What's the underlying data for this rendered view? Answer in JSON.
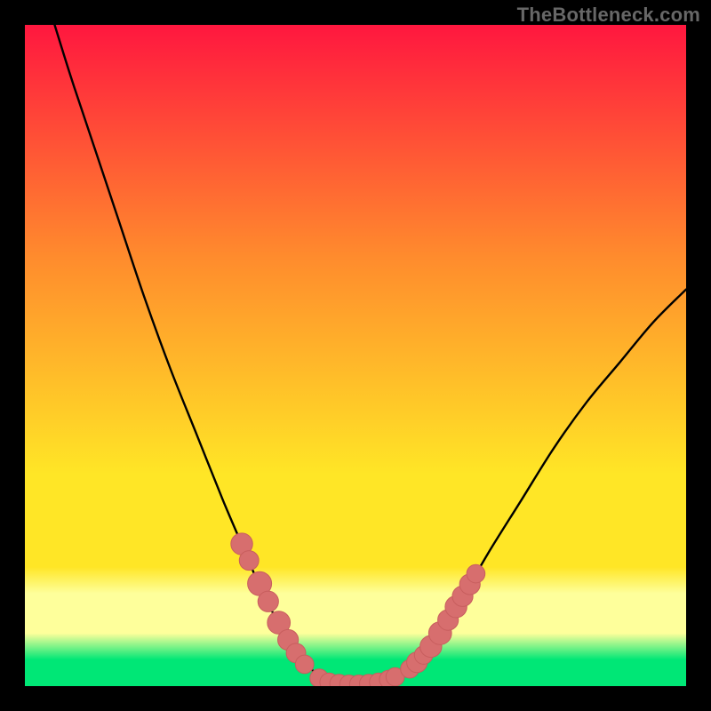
{
  "watermark": "TheBottleneck.com",
  "colors": {
    "frame": "#000000",
    "watermark_text": "#676767",
    "gradient_top": "#ff173f",
    "gradient_mid1": "#ff8b2d",
    "gradient_mid2": "#ffe626",
    "gradient_band": "#feff9b",
    "gradient_bottom": "#00e776",
    "curve_stroke": "#000000",
    "marker_fill": "#d76e6e",
    "marker_stroke": "#c85e5e"
  },
  "chart_data": {
    "type": "line",
    "title": "",
    "xlabel": "",
    "ylabel": "",
    "xlim": [
      0,
      100
    ],
    "ylim": [
      0,
      100
    ],
    "curve": [
      {
        "x": 4.5,
        "y": 100
      },
      {
        "x": 7,
        "y": 92
      },
      {
        "x": 10,
        "y": 83
      },
      {
        "x": 14,
        "y": 71
      },
      {
        "x": 18,
        "y": 59
      },
      {
        "x": 22,
        "y": 48
      },
      {
        "x": 26,
        "y": 38
      },
      {
        "x": 30,
        "y": 28
      },
      {
        "x": 33,
        "y": 21
      },
      {
        "x": 36,
        "y": 14
      },
      {
        "x": 39,
        "y": 8.5
      },
      {
        "x": 42,
        "y": 4
      },
      {
        "x": 45,
        "y": 1.2
      },
      {
        "x": 48,
        "y": 0.3
      },
      {
        "x": 51,
        "y": 0.3
      },
      {
        "x": 54,
        "y": 0.5
      },
      {
        "x": 57,
        "y": 1.5
      },
      {
        "x": 60,
        "y": 4
      },
      {
        "x": 63,
        "y": 8
      },
      {
        "x": 66,
        "y": 13
      },
      {
        "x": 70,
        "y": 20
      },
      {
        "x": 75,
        "y": 28
      },
      {
        "x": 80,
        "y": 36
      },
      {
        "x": 85,
        "y": 43
      },
      {
        "x": 90,
        "y": 49
      },
      {
        "x": 95,
        "y": 55
      },
      {
        "x": 100,
        "y": 60
      }
    ],
    "markers_left": [
      {
        "x": 32.8,
        "y": 21.5,
        "r": 1.3
      },
      {
        "x": 33.9,
        "y": 19.0,
        "r": 1.1
      },
      {
        "x": 35.5,
        "y": 15.5,
        "r": 1.5
      },
      {
        "x": 36.8,
        "y": 12.8,
        "r": 1.2
      },
      {
        "x": 38.4,
        "y": 9.6,
        "r": 1.4
      },
      {
        "x": 39.8,
        "y": 7.0,
        "r": 1.2
      },
      {
        "x": 41.0,
        "y": 5.0,
        "r": 1.1
      },
      {
        "x": 42.3,
        "y": 3.3,
        "r": 1.0
      }
    ],
    "markers_bottom": [
      {
        "x": 44.5,
        "y": 1.2,
        "r": 1.0
      },
      {
        "x": 46.0,
        "y": 0.6,
        "r": 1.0
      },
      {
        "x": 47.5,
        "y": 0.4,
        "r": 1.0
      },
      {
        "x": 49.0,
        "y": 0.3,
        "r": 1.0
      },
      {
        "x": 50.5,
        "y": 0.3,
        "r": 1.0
      },
      {
        "x": 52.0,
        "y": 0.4,
        "r": 1.0
      },
      {
        "x": 53.5,
        "y": 0.6,
        "r": 1.0
      },
      {
        "x": 55.0,
        "y": 1.0,
        "r": 1.0
      },
      {
        "x": 56.0,
        "y": 1.4,
        "r": 1.0
      }
    ],
    "markers_right": [
      {
        "x": 58.2,
        "y": 2.6,
        "r": 1.0
      },
      {
        "x": 59.3,
        "y": 3.6,
        "r": 1.2
      },
      {
        "x": 60.3,
        "y": 4.7,
        "r": 1.0
      },
      {
        "x": 61.4,
        "y": 6.0,
        "r": 1.3
      },
      {
        "x": 62.8,
        "y": 8.0,
        "r": 1.4
      },
      {
        "x": 64.0,
        "y": 10.0,
        "r": 1.2
      },
      {
        "x": 65.2,
        "y": 12.0,
        "r": 1.3
      },
      {
        "x": 66.2,
        "y": 13.6,
        "r": 1.2
      },
      {
        "x": 67.3,
        "y": 15.4,
        "r": 1.2
      },
      {
        "x": 68.2,
        "y": 17.0,
        "r": 1.0
      }
    ]
  }
}
